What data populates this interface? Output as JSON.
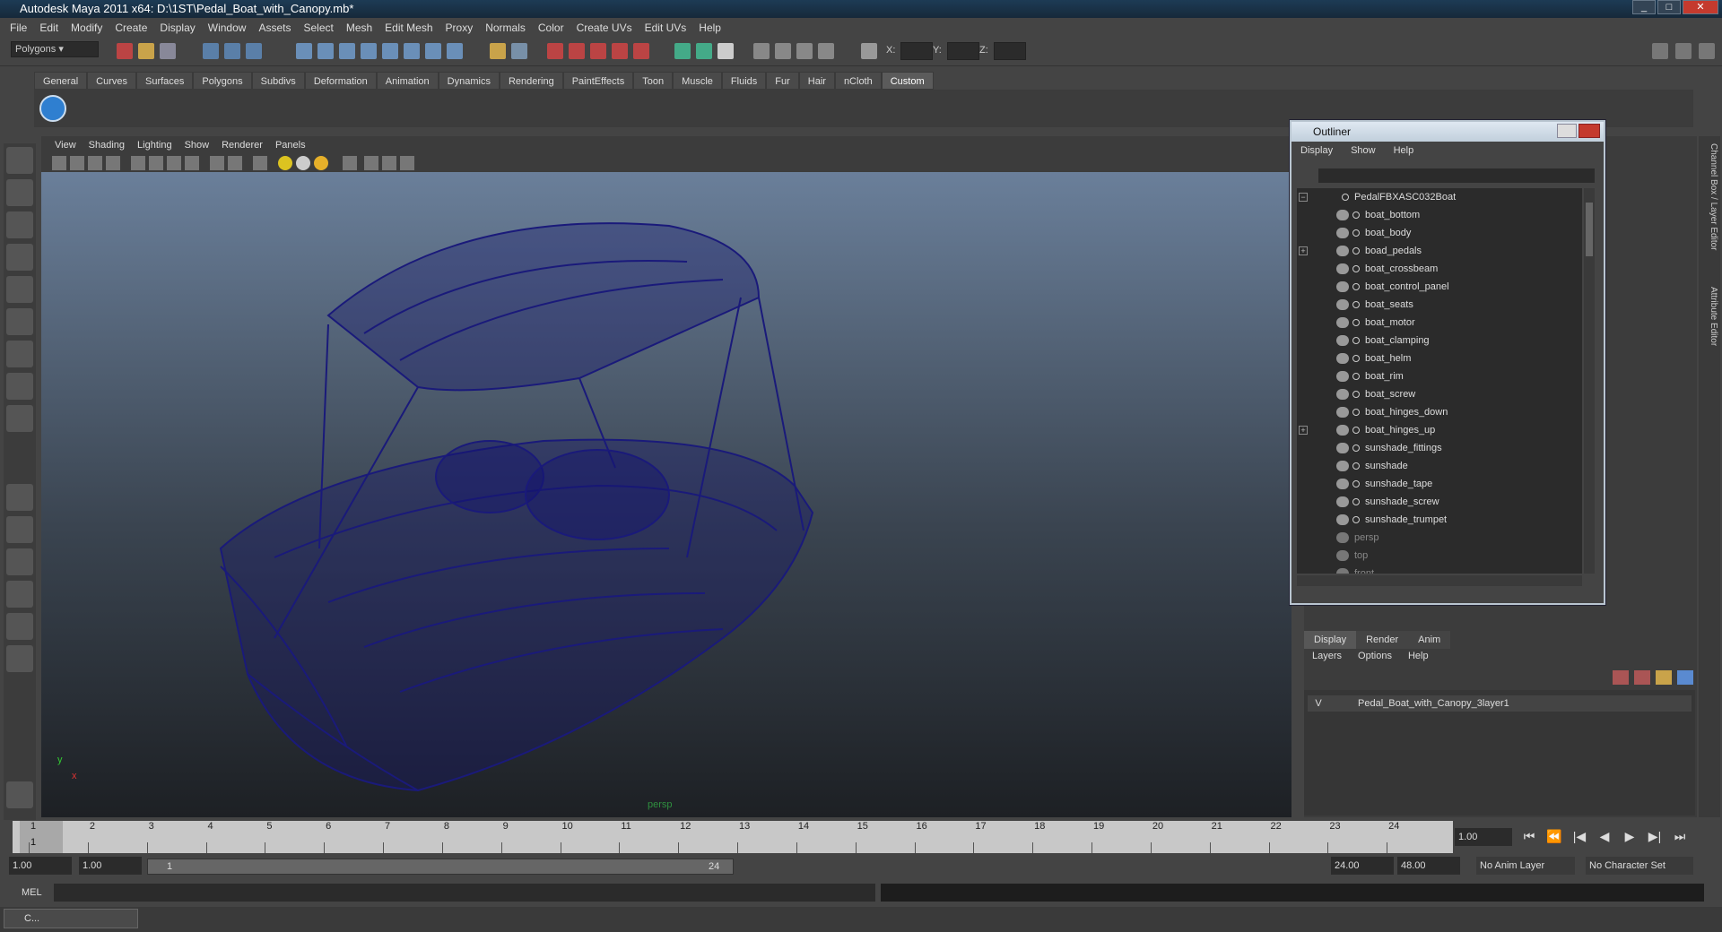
{
  "app": {
    "title": "Autodesk Maya 2011 x64: D:\\1ST\\Pedal_Boat_with_Canopy.mb*"
  },
  "menu": [
    "File",
    "Edit",
    "Modify",
    "Create",
    "Display",
    "Window",
    "Assets",
    "Select",
    "Mesh",
    "Edit Mesh",
    "Proxy",
    "Normals",
    "Color",
    "Create UVs",
    "Edit UVs",
    "Help"
  ],
  "toolbar": {
    "mode": "Polygons",
    "x_label": "X:",
    "y_label": "Y:",
    "z_label": "Z:"
  },
  "shelf_tabs": [
    "General",
    "Curves",
    "Surfaces",
    "Polygons",
    "Subdivs",
    "Deformation",
    "Animation",
    "Dynamics",
    "Rendering",
    "PaintEffects",
    "Toon",
    "Muscle",
    "Fluids",
    "Fur",
    "Hair",
    "nCloth",
    "Custom"
  ],
  "shelf_active": "Custom",
  "viewport": {
    "menu": [
      "View",
      "Shading",
      "Lighting",
      "Show",
      "Renderer",
      "Panels"
    ],
    "camera_label": "persp",
    "axis_x": "x",
    "axis_y": "y"
  },
  "outliner": {
    "title": "Outliner",
    "menu": [
      "Display",
      "Show",
      "Help"
    ],
    "root": "PedalFBXASC032Boat",
    "items": [
      "boat_bottom",
      "boat_body",
      "boad_pedals",
      "boat_crossbeam",
      "boat_control_panel",
      "boat_seats",
      "boat_motor",
      "boat_clamping",
      "boat_helm",
      "boat_rim",
      "boat_screw",
      "boat_hinges_down",
      "boat_hinges_up",
      "sunshade_fittings",
      "sunshade",
      "sunshade_tape",
      "sunshade_screw",
      "sunshade_trumpet"
    ],
    "cameras": [
      "persp",
      "top",
      "front"
    ]
  },
  "layers": {
    "tabs": [
      "Display",
      "Render",
      "Anim"
    ],
    "active_tab": "Display",
    "menu": [
      "Layers",
      "Options",
      "Help"
    ],
    "visible_flag": "V",
    "layer_name": "Pedal_Boat_with_Canopy_3layer1"
  },
  "side_tabs": [
    "Channel Box / Layer Editor",
    "Attribute Editor"
  ],
  "timeline": {
    "ticks": [
      "1",
      "2",
      "3",
      "4",
      "5",
      "6",
      "7",
      "8",
      "9",
      "10",
      "11",
      "12",
      "13",
      "14",
      "15",
      "16",
      "17",
      "18",
      "19",
      "20",
      "21",
      "22",
      "23",
      "24"
    ],
    "current_frame": "1.00",
    "playhead": "1"
  },
  "range": {
    "start": "1.00",
    "start2": "1.00",
    "slider_start": "1",
    "slider_end": "24",
    "end": "24.00",
    "end2": "48.00",
    "anim_layer": "No Anim Layer",
    "character_set": "No Character Set"
  },
  "command": {
    "label": "MEL"
  },
  "taskbar": {
    "item": "C..."
  }
}
